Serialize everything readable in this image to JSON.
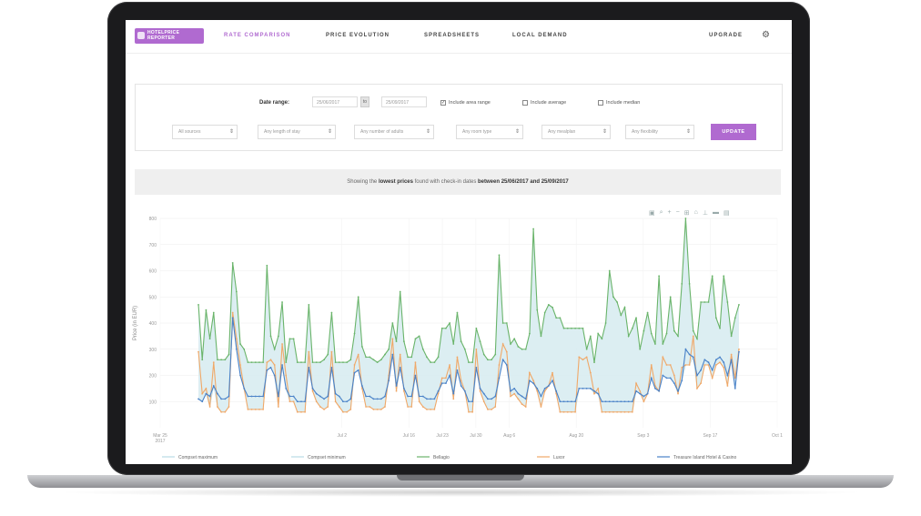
{
  "app": {
    "logo_text": "HOTELPRICE\nREPORTER",
    "brand_color": "#b06ad0"
  },
  "nav": {
    "items": [
      {
        "label": "RATE COMPARISON",
        "active": true
      },
      {
        "label": "PRICE EVOLUTION",
        "active": false
      },
      {
        "label": "SPREADSHEETS",
        "active": false
      },
      {
        "label": "LOCAL DEMAND",
        "active": false
      }
    ],
    "upgrade_label": "UPGRADE",
    "settings_icon": "gear-icon"
  },
  "filters": {
    "date_range_label": "Date range:",
    "date_from": "25/06/2017",
    "date_sep": "to",
    "date_to": "25/09/2017",
    "checkboxes": [
      {
        "label": "Include area range",
        "checked": true
      },
      {
        "label": "Include average",
        "checked": false
      },
      {
        "label": "Include median",
        "checked": false
      }
    ],
    "selects": [
      {
        "value": "All sources"
      },
      {
        "value": "Any length of stay"
      },
      {
        "value": "Any number of adults"
      },
      {
        "value": "Any room type"
      },
      {
        "value": "Any mealplan"
      },
      {
        "value": "Any flexibility"
      }
    ],
    "update_label": "UPDATE"
  },
  "info": {
    "prefix": "Showing the ",
    "bold1": "lowest prices",
    "middle": " found with check-in dates ",
    "bold2": "between 25/06/2017 and 25/09/2017"
  },
  "modebar_icons": [
    "camera-icon",
    "zoom-icon",
    "plus-icon",
    "minus-icon",
    "autoscale-icon",
    "reset-icon",
    "spike-icon",
    "hover-icon",
    "compare-icon"
  ],
  "chart_data": {
    "type": "line",
    "ylabel": "Price (in EUR)",
    "ylim": [
      0,
      800
    ],
    "yticks": [
      100,
      200,
      300,
      400,
      500,
      600,
      700,
      800
    ],
    "x_tick_labels": [
      "Mar 25\n2017",
      "Jul 2",
      "Jul 16",
      "Jul 23",
      "Jul 30",
      "Aug 6",
      "Aug 20",
      "Sep 3",
      "Sep 17",
      "Oct 1"
    ],
    "x_tick_days": [
      0,
      38,
      52,
      59,
      66,
      73,
      87,
      101,
      115,
      129
    ],
    "x_start_day": 8,
    "x_end_day": 121,
    "legend": [
      "Compset maximum",
      "Compset minimum",
      "Bellagio",
      "Luxor",
      "Treasure Island Hotel & Casino"
    ],
    "colors": {
      "range_fill": "#d8ecf1",
      "range_line": "#b9dbe5",
      "Bellagio": "#6ab46a",
      "Luxor": "#f0a868",
      "Treasure Island Hotel & Casino": "#4a82c8"
    },
    "series": [
      {
        "name": "Bellagio",
        "values": [
          470,
          260,
          450,
          340,
          440,
          260,
          260,
          260,
          280,
          630,
          520,
          320,
          300,
          250,
          250,
          250,
          250,
          250,
          620,
          350,
          300,
          350,
          480,
          250,
          340,
          340,
          250,
          250,
          250,
          470,
          250,
          250,
          250,
          260,
          280,
          440,
          250,
          250,
          250,
          250,
          260,
          360,
          500,
          310,
          270,
          270,
          260,
          250,
          260,
          280,
          300,
          400,
          330,
          520,
          330,
          270,
          270,
          340,
          350,
          300,
          270,
          250,
          250,
          270,
          380,
          380,
          400,
          320,
          440,
          330,
          300,
          250,
          250,
          380,
          330,
          280,
          260,
          260,
          280,
          660,
          400,
          400,
          320,
          340,
          310,
          300,
          300,
          360,
          760,
          450,
          350,
          440,
          470,
          460,
          420,
          420,
          380,
          380,
          380,
          380,
          380,
          380,
          300,
          350,
          250,
          360,
          340,
          400,
          600,
          500,
          480,
          430,
          460,
          350,
          380,
          420,
          300,
          370,
          440,
          360,
          320,
          580,
          320,
          360,
          500,
          370,
          350,
          550,
          800,
          550,
          370,
          340,
          480,
          480,
          480,
          580,
          420,
          380,
          580,
          480,
          350,
          420,
          470
        ]
      },
      {
        "name": "Luxor",
        "values": [
          290,
          130,
          150,
          80,
          250,
          80,
          60,
          60,
          80,
          440,
          340,
          240,
          150,
          70,
          70,
          70,
          70,
          70,
          250,
          260,
          240,
          80,
          320,
          200,
          100,
          100,
          60,
          60,
          60,
          290,
          140,
          100,
          80,
          70,
          80,
          290,
          100,
          80,
          60,
          60,
          70,
          240,
          280,
          150,
          80,
          80,
          70,
          70,
          70,
          80,
          200,
          340,
          140,
          280,
          140,
          80,
          80,
          250,
          100,
          80,
          70,
          70,
          70,
          130,
          190,
          190,
          240,
          110,
          270,
          180,
          140,
          60,
          60,
          300,
          140,
          100,
          70,
          70,
          80,
          240,
          320,
          290,
          120,
          130,
          110,
          90,
          80,
          210,
          180,
          140,
          80,
          140,
          160,
          210,
          130,
          60,
          60,
          60,
          60,
          60,
          270,
          260,
          270,
          210,
          130,
          150,
          60,
          60,
          60,
          60,
          60,
          60,
          60,
          60,
          60,
          170,
          140,
          100,
          130,
          240,
          160,
          140,
          270,
          240,
          240,
          200,
          130,
          230,
          240,
          240,
          350,
          150,
          170,
          240,
          240,
          190,
          240,
          250,
          230,
          160,
          280,
          190,
          300
        ]
      },
      {
        "name": "Treasure Island Hotel & Casino",
        "values": [
          110,
          100,
          130,
          120,
          160,
          130,
          110,
          110,
          120,
          420,
          300,
          200,
          150,
          120,
          120,
          120,
          120,
          120,
          220,
          230,
          200,
          120,
          240,
          150,
          120,
          120,
          100,
          100,
          100,
          230,
          150,
          130,
          120,
          110,
          120,
          230,
          130,
          120,
          100,
          100,
          110,
          210,
          220,
          160,
          120,
          120,
          110,
          110,
          110,
          120,
          180,
          280,
          160,
          230,
          150,
          120,
          120,
          200,
          120,
          120,
          110,
          110,
          110,
          140,
          170,
          170,
          200,
          130,
          220,
          160,
          140,
          100,
          100,
          230,
          150,
          130,
          110,
          110,
          120,
          190,
          260,
          240,
          140,
          150,
          130,
          120,
          110,
          180,
          170,
          150,
          120,
          150,
          160,
          180,
          140,
          100,
          100,
          100,
          100,
          100,
          150,
          150,
          150,
          150,
          140,
          130,
          100,
          100,
          100,
          100,
          100,
          100,
          100,
          100,
          100,
          140,
          130,
          120,
          130,
          190,
          150,
          140,
          200,
          190,
          190,
          170,
          140,
          180,
          300,
          280,
          270,
          200,
          220,
          260,
          250,
          220,
          260,
          270,
          250,
          200,
          260,
          150,
          290
        ]
      }
    ]
  }
}
